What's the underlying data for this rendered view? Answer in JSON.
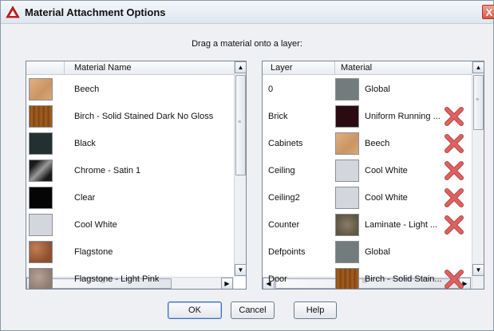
{
  "dialog": {
    "title": "Material Attachment Options",
    "close_label": "X",
    "instruction": "Drag a material onto a layer:"
  },
  "materials_panel": {
    "header": "Material Name",
    "items": [
      {
        "name": "Beech",
        "swatch": "wood-light"
      },
      {
        "name": "Birch - Solid Stained Dark No Gloss",
        "swatch": "wood-dark"
      },
      {
        "name": "Black",
        "swatch": "black"
      },
      {
        "name": "Chrome - Satin 1",
        "swatch": "chrome"
      },
      {
        "name": "Clear",
        "swatch": "clear"
      },
      {
        "name": "Cool White",
        "swatch": "cool-white"
      },
      {
        "name": "Flagstone",
        "swatch": "flagstone"
      },
      {
        "name": "Flagstone - Light Pink",
        "swatch": "flagstone-pink"
      }
    ]
  },
  "layers_panel": {
    "header_layer": "Layer",
    "header_material": "Material",
    "rows": [
      {
        "layer": "0",
        "material": "Global",
        "swatch": "global",
        "removable": false
      },
      {
        "layer": "Brick",
        "material": "Uniform Running ...",
        "swatch": "brick",
        "removable": true
      },
      {
        "layer": "Cabinets",
        "material": "Beech",
        "swatch": "wood-light",
        "removable": true
      },
      {
        "layer": "Ceiling",
        "material": "Cool White",
        "swatch": "cool-white",
        "removable": true
      },
      {
        "layer": "Ceiling2",
        "material": "Cool White",
        "swatch": "cool-white",
        "removable": true
      },
      {
        "layer": "Counter",
        "material": "Laminate - Light ...",
        "swatch": "laminate",
        "removable": true
      },
      {
        "layer": "Defpoints",
        "material": "Global",
        "swatch": "global",
        "removable": false
      },
      {
        "layer": "Door",
        "material": "Birch - Solid Stain...",
        "swatch": "wood-dark",
        "removable": true
      }
    ]
  },
  "buttons": {
    "ok": "OK",
    "cancel": "Cancel",
    "help": "Help"
  },
  "scroll_glyphs": {
    "up": "▲",
    "down": "▼",
    "left": "◀",
    "right": "▶",
    "grip_v": "≡",
    "grip_h": "III"
  },
  "colors": {
    "title_icon": "#d32020",
    "remove_icon": "#e06060",
    "default_button_border": "#3d6fb4"
  },
  "swatch_styles": {
    "wood-light": "linear-gradient(135deg,#e0b080,#c99563 60%,#d8a878)",
    "wood-dark": "repeating-linear-gradient(90deg,#8a4a18 0,#a2611f 3px,#7a3e12 6px)",
    "black": "#233030",
    "chrome": "linear-gradient(135deg,#1a1a1a 20%,#9a9a9a 50%,#1a1a1a 80%)",
    "clear": "#050505",
    "cool-white": "#d4d6dd",
    "flagstone": "radial-gradient(circle at 30% 30%,#c07e52,#8d5030 70%)",
    "flagstone-pink": "radial-gradient(circle at 40% 40%,#b8a196,#8e7a70 75%)",
    "global": "#737c7c",
    "brick": "#2b0b12",
    "laminate": "radial-gradient(circle at 50% 50%,#8a7c62,#5d5444 80%)"
  }
}
